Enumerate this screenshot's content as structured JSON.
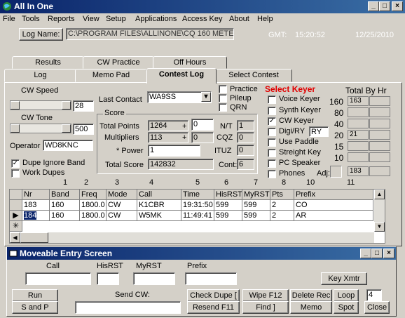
{
  "window": {
    "title": "All In One"
  },
  "menu": [
    "File",
    "Tools",
    "Reports",
    "View",
    "Setup",
    "Applications",
    "Access Key",
    "About",
    "Help"
  ],
  "logname": {
    "label": "Log Name:",
    "path": "C:\\PROGRAM FILES\\ALLINONE\\CQ 160 METE"
  },
  "gmt": {
    "label": "GMT:",
    "time": "15:20:52",
    "date": "12/25/2010"
  },
  "tabs_row1": [
    "Results",
    "CW Practice",
    "Off Hours"
  ],
  "tabs_row2": [
    "Log",
    "Memo Pad",
    "Contest Log",
    "Select Contest"
  ],
  "cw_speed": {
    "label": "CW Speed",
    "value": "28"
  },
  "cw_tone": {
    "label": "CW Tone",
    "value": "500"
  },
  "operator": {
    "label": "Operator",
    "value": "WD8KNC"
  },
  "dupe_ignore": {
    "label": "Dupe Ignore Band",
    "checked": true
  },
  "work_dupes": {
    "label": "Work Dupes",
    "checked": false
  },
  "last_contact": {
    "label": "Last Contact",
    "value": "WA9SS"
  },
  "options": [
    {
      "label": "Practice"
    },
    {
      "label": "Pileup"
    },
    {
      "label": "QRN"
    }
  ],
  "score": {
    "legend": "Score",
    "total_points_label": "Total Points",
    "total_points": "1264",
    "plus1": "+",
    "plus1_val": "0",
    "multipliers_label": "Multipliers",
    "multipliers": "113",
    "plus2": "+",
    "plus2_val": "0",
    "power_label": "* Power",
    "power": "1",
    "total_score_label": "Total Score",
    "total_score": "142832",
    "nt_label": "N/T",
    "nt": "1",
    "cqz_label": "CQZ",
    "cqz": "0",
    "ituz_label": "ITUZ",
    "ituz": "0",
    "cont_label": "Cont:",
    "cont": "6"
  },
  "keyer": {
    "title": "Select Keyer",
    "items": [
      {
        "label": "Voice Keyer",
        "checked": false
      },
      {
        "label": "Synth Keyer",
        "checked": false
      },
      {
        "label": "CW Keyer",
        "checked": true
      },
      {
        "label": "Digi/RY",
        "checked": false,
        "extra": "RY"
      },
      {
        "label": "Use Paddle",
        "checked": false
      },
      {
        "label": "Streight Key",
        "checked": false
      },
      {
        "label": "PC Speaker",
        "checked": false
      },
      {
        "label": "Phones",
        "checked": false
      }
    ],
    "adj_label": "Adj:"
  },
  "total_by_hr": {
    "title": "Total By Hr",
    "bands": [
      "160",
      "80",
      "40",
      "20",
      "15",
      "10"
    ],
    "values": [
      "163",
      "",
      "",
      "21",
      "",
      ""
    ],
    "footer": "183"
  },
  "col_numbers": [
    "1",
    "2",
    "3",
    "4",
    "5",
    "6",
    "7",
    "8",
    "10",
    "11"
  ],
  "grid": {
    "headers": [
      "Nr",
      "Band",
      "Freq",
      "Mode",
      "Call",
      "Time",
      "HisRST",
      "MyRST",
      "Pts",
      "Prefix"
    ],
    "rows": [
      [
        "183",
        "160",
        "1800.0",
        "CW",
        "K1CBR",
        "19:31:50",
        "599",
        "599",
        "2",
        "CO"
      ],
      [
        "184",
        "160",
        "1800.0",
        "CW",
        "W5MK",
        "11:49:41",
        "599",
        "599",
        "2",
        "AR"
      ]
    ]
  },
  "entry": {
    "title": "Moveable Entry Screen",
    "call_label": "Call",
    "hisrst_label": "HisRST",
    "myrst_label": "MyRST",
    "prefix_label": "Prefix",
    "key_xmtr": "Key Xmtr",
    "run": "Run",
    "s_and_p": "S and P",
    "send_cw_label": "Send CW:",
    "check_dupe": "Check Dupe [",
    "resend": "Resend F11",
    "wipe": "Wipe F12",
    "find": "Find ]",
    "delete_rec": "Delete Rec",
    "memo": "Memo",
    "loop": "Loop",
    "spot": "Spot",
    "loop_count": "4",
    "close": "Close"
  }
}
